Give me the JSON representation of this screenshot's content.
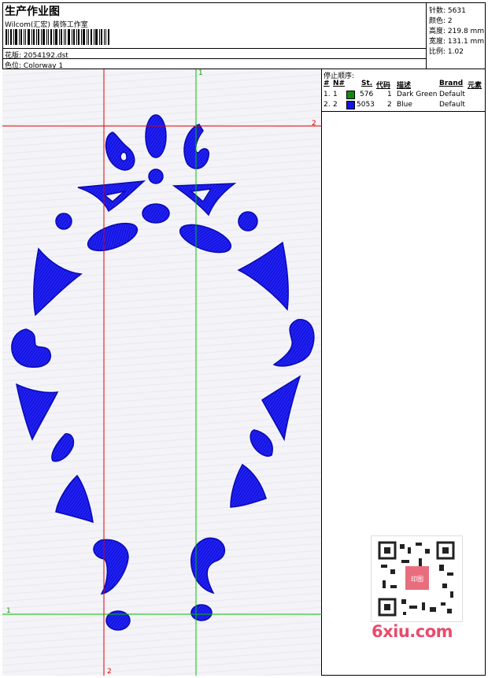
{
  "header": {
    "title": "生产作业图",
    "company": "Wilcom(汇宏) 装饰工作室",
    "pattern_label": "花版:",
    "pattern_value": "2054192.dst",
    "colorway_label": "色位:",
    "colorway_value": "Colorway 1"
  },
  "stats": {
    "stitches_label": "针数:",
    "stitches_value": "5631",
    "colors_label": "颜色:",
    "colors_value": "2",
    "height_label": "高度:",
    "height_value": "219.8 mm",
    "width_label": "宽度:",
    "width_value": "131.1 mm",
    "scale_label": "比例:",
    "scale_value": "1.02"
  },
  "stop_sequence": {
    "heading": "停止顺序:",
    "columns": [
      "#",
      "N#",
      "St.",
      "代码",
      "描述",
      "Brand",
      "元素"
    ],
    "rows": [
      {
        "num": "1.",
        "n": "1",
        "color": "#128a12",
        "st": "576",
        "code": "1",
        "desc": "Dark Green",
        "brand": "Default"
      },
      {
        "num": "2.",
        "n": "2",
        "color": "#1414e6",
        "st": "5053",
        "code": "2",
        "desc": "Blue",
        "brand": "Default"
      }
    ]
  },
  "canvas": {
    "marker_top": "1",
    "marker_right": "2",
    "marker_bottom": "2",
    "marker_left": "1",
    "red_guide_color": "#e00000",
    "green_guide_color": "#00c000",
    "embroidery_color": "#1414e6"
  },
  "watermark": {
    "logo": "6xiu.com",
    "badge": "印图"
  },
  "icons": {
    "barcode": "barcode-icon",
    "qr": "qr-code-icon"
  }
}
